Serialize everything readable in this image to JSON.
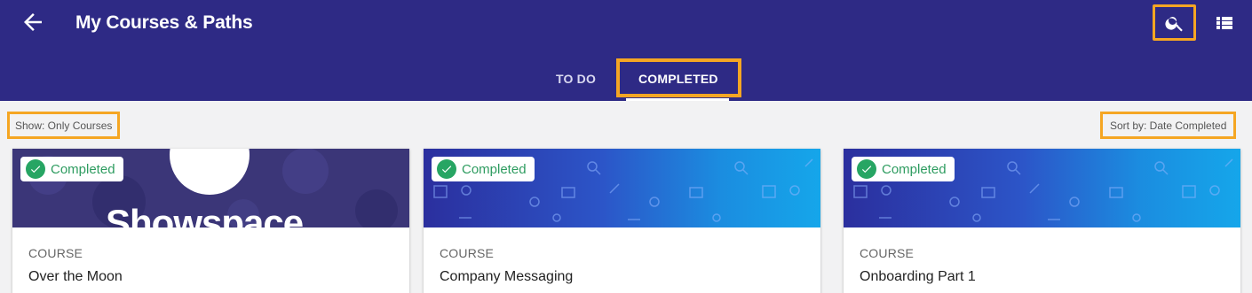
{
  "appbar": {
    "title": "My Courses & Paths",
    "icons": {
      "back": "arrow-left-icon",
      "search": "search-icon",
      "menu": "list-view-icon"
    }
  },
  "tabs": [
    {
      "label": "TO DO",
      "active": false
    },
    {
      "label": "COMPLETED",
      "active": true
    }
  ],
  "filter": {
    "label": "Show: Only Courses"
  },
  "sort": {
    "label": "Sort by: Date Completed"
  },
  "cards": [
    {
      "status": "Completed",
      "kind": "COURSE",
      "title": "Over the Moon",
      "banner_text": "Showspace"
    },
    {
      "status": "Completed",
      "kind": "COURSE",
      "title": "Company Messaging"
    },
    {
      "status": "Completed",
      "kind": "COURSE",
      "title": "Onboarding Part 1"
    }
  ],
  "colors": {
    "appbar": "#2e2a85",
    "highlight": "#f5a623",
    "success": "#27a563"
  }
}
